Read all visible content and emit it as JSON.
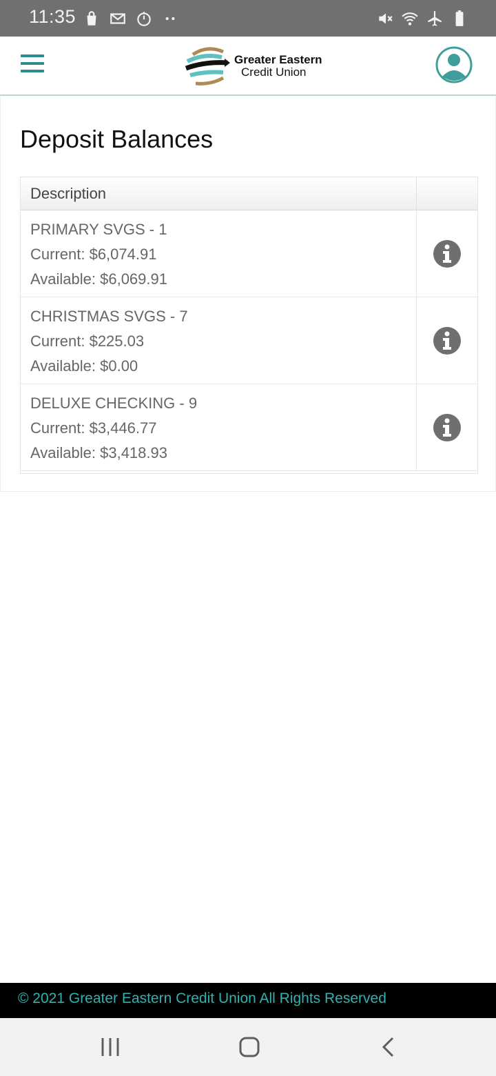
{
  "status_bar": {
    "time": "11:35",
    "left_icons": [
      "shopping-bag-icon",
      "gmail-icon",
      "timer-icon",
      "more-dots-icon"
    ],
    "right_icons": [
      "mute-icon",
      "wifi-icon",
      "airplane-mode-icon",
      "battery-icon"
    ]
  },
  "header": {
    "logo_line1": "Greater Eastern",
    "logo_line2": "Credit Union",
    "accent_color": "#2e8c8a"
  },
  "main": {
    "title": "Deposit Balances",
    "table": {
      "columns": [
        "Description",
        ""
      ],
      "rows": [
        {
          "name": "PRIMARY SVGS - 1",
          "current": "Current: $6,074.91",
          "available": "Available: $6,069.91"
        },
        {
          "name": "CHRISTMAS SVGS - 7",
          "current": "Current: $225.03",
          "available": "Available: $0.00"
        },
        {
          "name": "DELUXE CHECKING - 9",
          "current": "Current: $3,446.77",
          "available": "Available: $3,418.93"
        }
      ]
    }
  },
  "footer": {
    "copyright": "© 2021 Greater Eastern Credit Union All Rights Reserved",
    "text_color": "#2fb3b0"
  },
  "nav_bar": {
    "buttons": [
      "recent-apps-icon",
      "home-icon",
      "back-icon"
    ]
  }
}
